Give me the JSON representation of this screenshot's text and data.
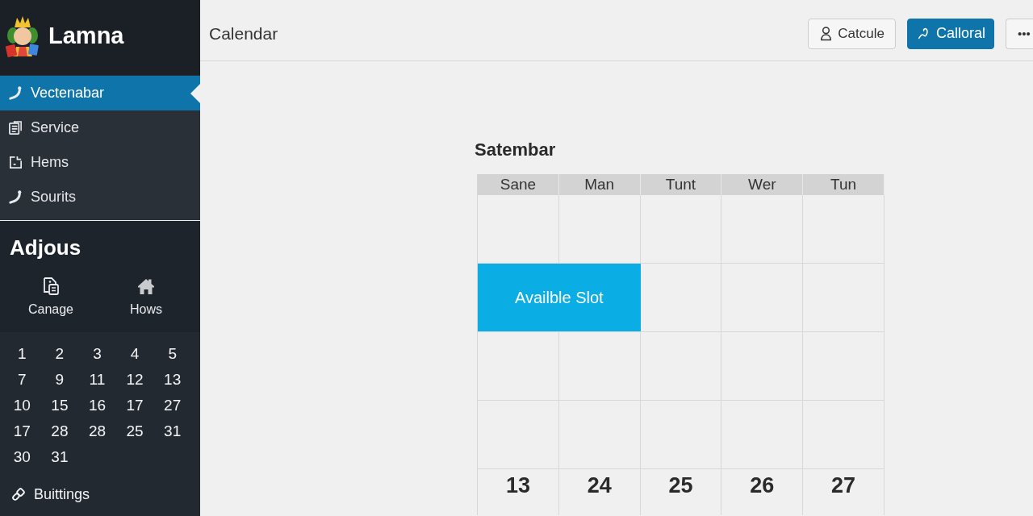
{
  "sidebar": {
    "brand": "Lamna",
    "nav": [
      {
        "label": "Vectenabar",
        "selected": true
      },
      {
        "label": "Service",
        "selected": false
      },
      {
        "label": "Hems",
        "selected": false
      },
      {
        "label": "Sourits",
        "selected": false
      }
    ],
    "section_title": "Adjous",
    "shortcuts": [
      {
        "label": "Canage"
      },
      {
        "label": "Hows"
      }
    ],
    "mini_calendar": [
      [
        "1",
        "2",
        "3",
        "4",
        "5"
      ],
      [
        "7",
        "9",
        "11",
        "12",
        "13"
      ],
      [
        "10",
        "15",
        "16",
        "17",
        "27"
      ],
      [
        "17",
        "28",
        "28",
        "25",
        "31"
      ],
      [
        "30",
        "31"
      ]
    ],
    "footer_link": "Buittings"
  },
  "header": {
    "title": "Calendar",
    "buttons": [
      {
        "label": "Catcule",
        "kind": "default"
      },
      {
        "label": "Calloral",
        "kind": "primary"
      },
      {
        "label": "•••",
        "kind": "more"
      }
    ]
  },
  "calendar": {
    "title": "Satembar",
    "weekdays": [
      "Sane",
      "Man",
      "Tunt",
      "Wer",
      "Tun"
    ],
    "rows": [
      {
        "kind": "empty"
      },
      {
        "kind": "events",
        "events": [
          {
            "label": "Availble Slot",
            "kind": "wide"
          }
        ]
      },
      {
        "kind": "empty"
      },
      {
        "kind": "empty"
      },
      {
        "kind": "dates",
        "dates": [
          "13",
          "24",
          "25",
          "26",
          "27"
        ]
      }
    ]
  }
}
